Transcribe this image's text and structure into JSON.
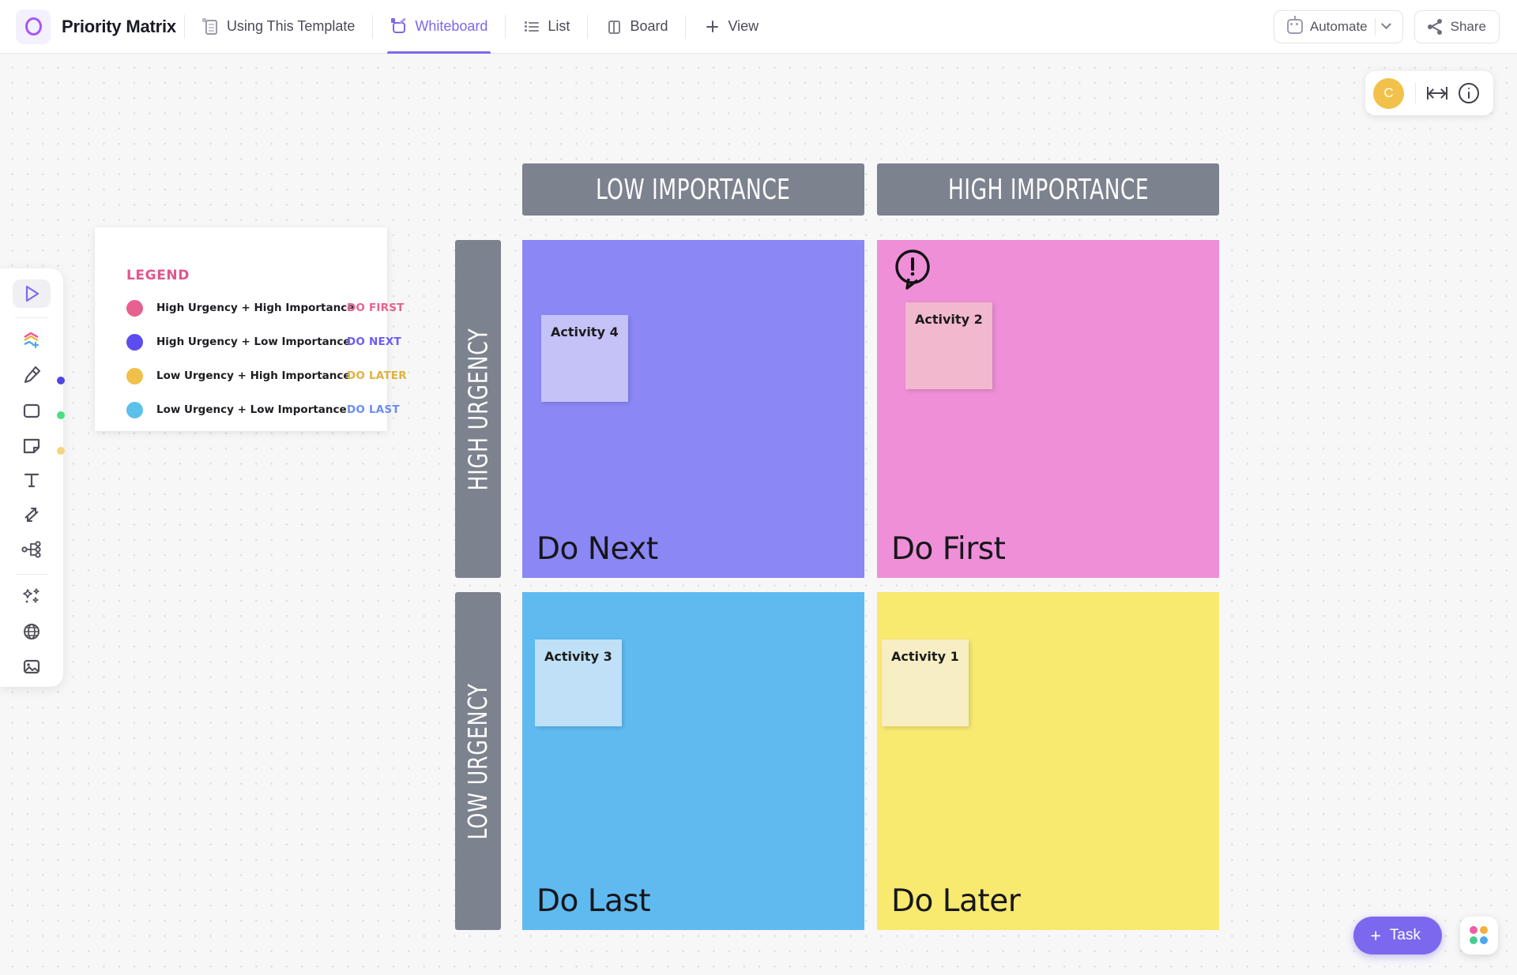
{
  "app": {
    "title": "Priority Matrix",
    "logo_icon": "clickup-circle-logo"
  },
  "tabs": [
    {
      "label": "Using This Template",
      "icon": "doc-icon",
      "active": false
    },
    {
      "label": "Whiteboard",
      "icon": "whiteboard-icon",
      "active": true
    },
    {
      "label": "List",
      "icon": "list-icon",
      "active": false
    },
    {
      "label": "Board",
      "icon": "board-icon",
      "active": false
    },
    {
      "label": "View",
      "icon": "plus-icon",
      "active": false
    }
  ],
  "topbar_right": {
    "automate_label": "Automate",
    "automate_icon": "robot-icon",
    "automate_caret_icon": "chevron-down-icon",
    "share_label": "Share",
    "share_icon": "share-icon"
  },
  "view_controls": {
    "avatar_initial": "C",
    "fit_icon": "fit-to-screen-icon",
    "info_icon": "info-icon"
  },
  "toolbar": {
    "items": [
      {
        "name": "select-tool",
        "icon": "cursor-icon",
        "selected": true,
        "dot": ""
      },
      {
        "name": "shapes-tool",
        "icon": "add-shape-icon",
        "selected": false,
        "dot": ""
      },
      {
        "name": "pen-tool",
        "icon": "highlighter-pen-icon",
        "selected": false,
        "dot": "#4f46e5"
      },
      {
        "name": "rectangle-tool",
        "icon": "square-icon",
        "selected": false,
        "dot": "#4ade80"
      },
      {
        "name": "sticky-note-tool",
        "icon": "sticky-note-icon",
        "selected": false,
        "dot": "#f5d380"
      },
      {
        "name": "text-tool",
        "icon": "text-t-icon",
        "selected": false,
        "dot": ""
      },
      {
        "name": "connector-tool",
        "icon": "connector-arrows-icon",
        "selected": false,
        "dot": ""
      },
      {
        "name": "mindmap-tool",
        "icon": "mindmap-icon",
        "selected": false,
        "dot": ""
      },
      {
        "name": "ai-tool",
        "icon": "magic-wand-icon",
        "selected": false,
        "dot": ""
      },
      {
        "name": "embed-tool",
        "icon": "globe-icon",
        "selected": false,
        "dot": ""
      },
      {
        "name": "image-tool",
        "icon": "image-icon",
        "selected": false,
        "dot": ""
      }
    ]
  },
  "legend": {
    "title": "LEGEND",
    "rows": [
      {
        "color": "#e8608f",
        "text": "High Urgency + High Importance",
        "tag": "DO FIRST",
        "tag_color": "#e8608f"
      },
      {
        "color": "#5b4df0",
        "text": "High Urgency + Low Importance",
        "tag": "DO NEXT",
        "tag_color": "#6b5cf5"
      },
      {
        "color": "#f0c04a",
        "text": "Low Urgency + High Importance",
        "tag": "DO LATER",
        "tag_color": "#e0b13c"
      },
      {
        "color": "#5cc0ec",
        "text": "Low Urgency + Low Importance",
        "tag": "DO LAST",
        "tag_color": "#6b8cf5"
      }
    ]
  },
  "matrix": {
    "column_headers": [
      "LOW IMPORTANCE",
      "HIGH IMPORTANCE"
    ],
    "row_headers": [
      "HIGH URGENCY",
      "LOW URGENCY"
    ],
    "header_bg": "#7c828e",
    "quadrants": [
      {
        "name": "do-next",
        "label": "Do Next",
        "color": "#8b87f5",
        "note": {
          "label": "Activity 4",
          "color": "#c5c2f8"
        }
      },
      {
        "name": "do-first",
        "label": "Do First",
        "color": "#ee8fd8",
        "note": {
          "label": "Activity 2",
          "color": "#f2b8cd"
        }
      },
      {
        "name": "do-last",
        "label": "Do Last",
        "color": "#5fbaf0",
        "note": {
          "label": "Activity 3",
          "color": "#bfe0f7"
        }
      },
      {
        "name": "do-later",
        "label": "Do Later",
        "color": "#f8e96f",
        "note": {
          "label": "Activity 1",
          "color": "#f7eec4"
        }
      }
    ],
    "annotation_icon": "alert-speech-bubble-icon"
  },
  "footer": {
    "task_label": "Task",
    "task_plus": "+",
    "apps_icon": "apps-grid-icon"
  }
}
